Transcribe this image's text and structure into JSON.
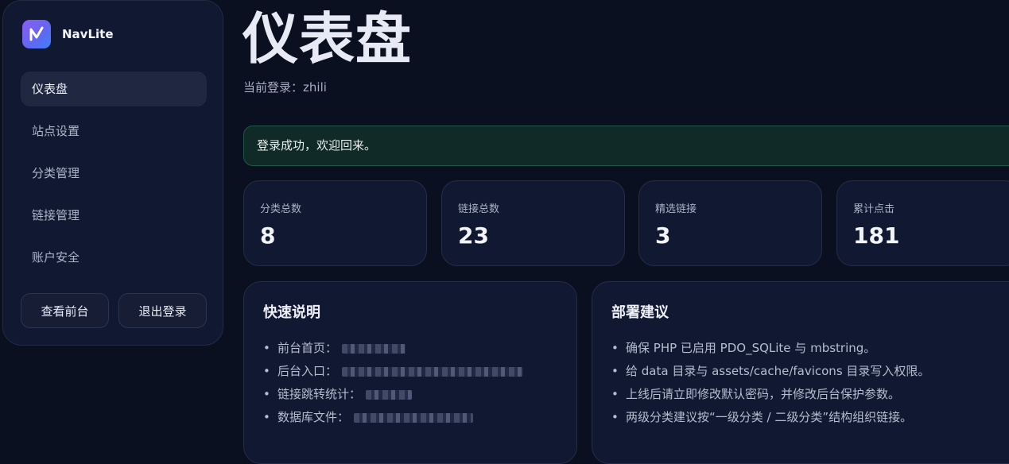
{
  "brand": {
    "name": "NavLite"
  },
  "sidebar": {
    "items": [
      {
        "label": "仪表盘",
        "active": true
      },
      {
        "label": "站点设置"
      },
      {
        "label": "分类管理"
      },
      {
        "label": "链接管理"
      },
      {
        "label": "账户安全"
      }
    ],
    "view_frontend": "查看前台",
    "logout": "退出登录"
  },
  "header": {
    "title": "仪表盘",
    "login_label": "当前登录：",
    "username": "zhili"
  },
  "alert": {
    "message": "登录成功，欢迎回来。"
  },
  "stats": [
    {
      "label": "分类总数",
      "value": "8"
    },
    {
      "label": "链接总数",
      "value": "23"
    },
    {
      "label": "精选链接",
      "value": "3"
    },
    {
      "label": "累计点击",
      "value": "181"
    }
  ],
  "quick": {
    "title": "快速说明",
    "items": [
      {
        "label": "前台首页："
      },
      {
        "label": "后台入口："
      },
      {
        "label": "链接跳转统计："
      },
      {
        "label": "数据库文件："
      }
    ]
  },
  "deploy": {
    "title": "部署建议",
    "items": [
      "确保 PHP 已启用 PDO_SQLite 与 mbstring。",
      "给 data 目录与 assets/cache/favicons 目录写入权限。",
      "上线后请立即修改默认密码，并修改后台保护参数。",
      "两级分类建议按“一级分类 / 二级分类”结构组织链接。"
    ]
  },
  "colors": {
    "background": "#0b1020",
    "panel": "#111831",
    "active_nav": "#1f2840",
    "success_bg": "#0f2a27"
  }
}
